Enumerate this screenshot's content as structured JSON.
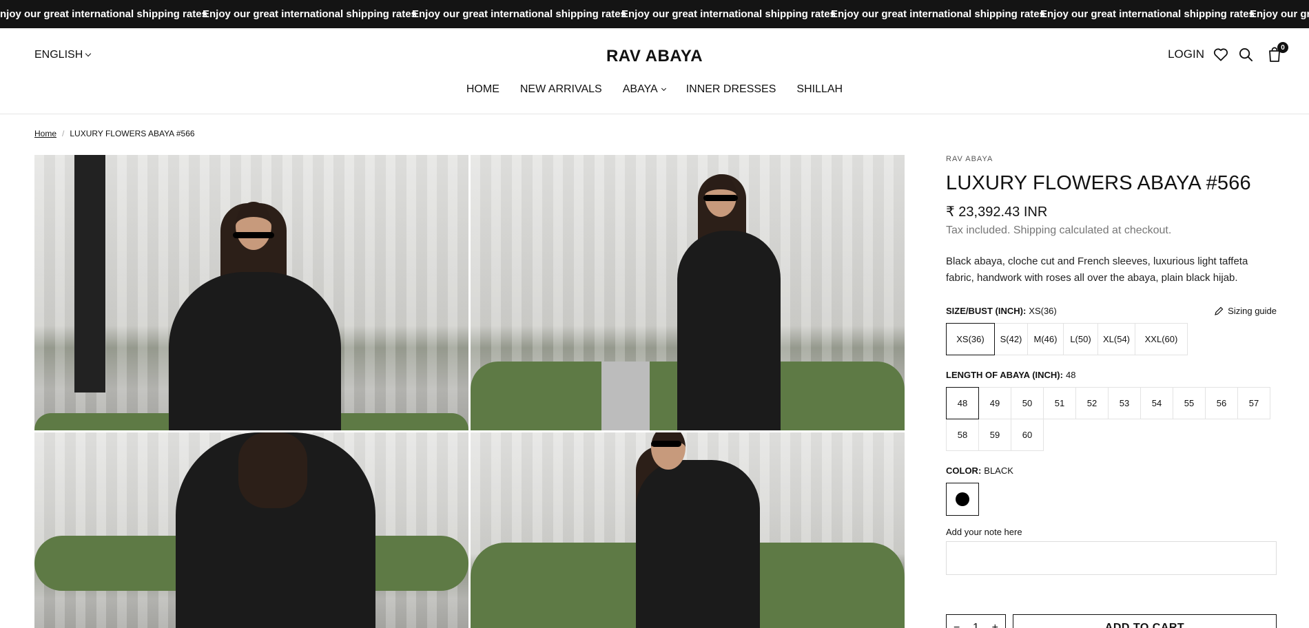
{
  "announcement": {
    "items": [
      "Enjoy our great international shipping rates",
      "Enjoy our great international shipping rates",
      "Enjoy our great international shipping rates",
      "Enjoy our great international shipping rates",
      "Enjoy our great international shipping rates",
      "Enjoy our great international shipping rates",
      "Enjoy our great international shipping rates"
    ]
  },
  "header": {
    "language": "ENGLISH",
    "logo": "RAV ABAYA",
    "login": "LOGIN",
    "cart_count": "0",
    "nav": [
      {
        "label": "HOME"
      },
      {
        "label": "NEW ARRIVALS"
      },
      {
        "label": "ABAYA",
        "has_dropdown": true
      },
      {
        "label": "INNER DRESSES"
      },
      {
        "label": "SHILLAH"
      }
    ]
  },
  "breadcrumb": {
    "home": "Home",
    "current": "LUXURY FLOWERS ABAYA #566"
  },
  "product": {
    "vendor": "RAV ABAYA",
    "title": "LUXURY FLOWERS ABAYA #566",
    "price": "₹ 23,392.43 INR",
    "tax_note": "Tax included. Shipping calculated at checkout.",
    "description": "Black abaya, cloche cut and French sleeves, luxurious light taffeta fabric, handwork with roses all over the abaya, plain black hijab.",
    "size": {
      "label": "SIZE/BUST (INCH):",
      "selected": "XS(36)",
      "guide": "Sizing guide",
      "options": [
        "XS(36)",
        "S(42)",
        "M(46)",
        "L(50)",
        "XL(54)",
        "XXL(60)"
      ]
    },
    "length": {
      "label": "LENGTH OF ABAYA (INCH):",
      "selected": "48",
      "options": [
        "48",
        "49",
        "50",
        "51",
        "52",
        "53",
        "54",
        "55",
        "56",
        "57",
        "58",
        "59",
        "60"
      ]
    },
    "color": {
      "label": "COLOR:",
      "selected": "BLACK",
      "swatch_hex": "#000000"
    },
    "note_label": "Add your note here",
    "quantity": "1",
    "add_to_cart": "ADD TO CART"
  }
}
